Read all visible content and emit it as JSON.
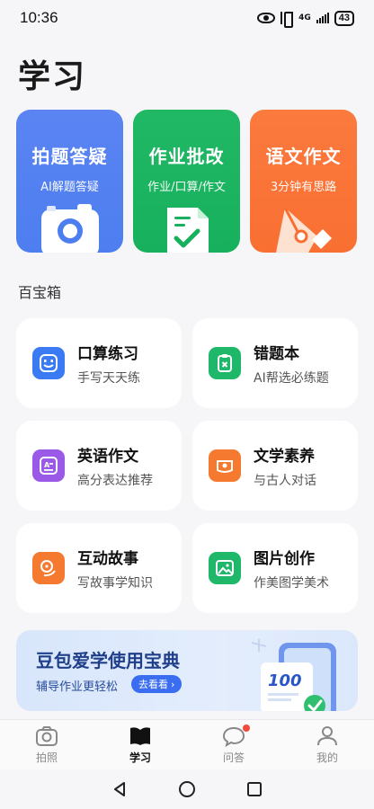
{
  "status_bar": {
    "time": "10:36",
    "network": "4G",
    "battery": "43"
  },
  "page_title": "学习",
  "features": [
    {
      "title": "拍题答疑",
      "subtitle": "AI解题答疑",
      "icon": "camera-icon",
      "color": "#5b84f2"
    },
    {
      "title": "作业批改",
      "subtitle": "作业/口算/作文",
      "icon": "checked-document-icon",
      "color": "#21b865"
    },
    {
      "title": "语文作文",
      "subtitle": "3分钟有思路",
      "icon": "pen-nib-icon",
      "color": "#fb7a3e"
    }
  ],
  "section_title": "百宝箱",
  "tools": [
    {
      "name": "口算练习",
      "desc": "手写天天练",
      "icon": "smile-face-icon",
      "color": "#3a7af2"
    },
    {
      "name": "错题本",
      "desc": "AI帮选必练题",
      "icon": "clipboard-x-icon",
      "color": "#1fb86a"
    },
    {
      "name": "英语作文",
      "desc": "高分表达推荐",
      "icon": "letter-a-icon",
      "color": "#9b59e8"
    },
    {
      "name": "文学素养",
      "desc": "与古人对话",
      "icon": "scroll-icon",
      "color": "#f57a30"
    },
    {
      "name": "互动故事",
      "desc": "写故事学知识",
      "icon": "chat-bubbles-icon",
      "color": "#f57a30"
    },
    {
      "name": "图片创作",
      "desc": "作美图学美术",
      "icon": "image-icon",
      "color": "#1fb86a"
    }
  ],
  "banner": {
    "title": "豆包爱学使用宝典",
    "subtitle": "辅导作业更轻松",
    "button": "去看看",
    "badge": "100"
  },
  "bottom_nav": [
    {
      "label": "拍照",
      "icon": "camera-outline-icon"
    },
    {
      "label": "学习",
      "icon": "book-icon"
    },
    {
      "label": "问答",
      "icon": "chat-icon"
    },
    {
      "label": "我的",
      "icon": "person-icon"
    }
  ]
}
